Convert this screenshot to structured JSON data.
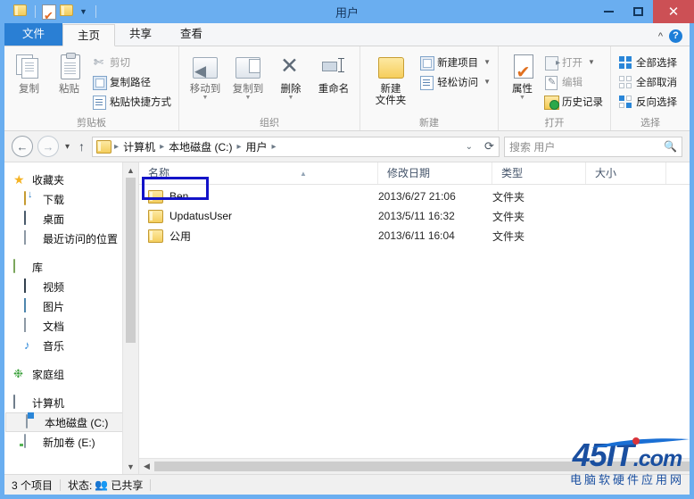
{
  "window": {
    "title": "用户",
    "controls": {
      "minimize": "最小化",
      "maximize": "最大化",
      "close": "关闭"
    }
  },
  "quick_access": {
    "items": [
      {
        "name": "folder-icon",
        "label": "属性"
      },
      {
        "name": "properties-icon",
        "label": "属性"
      },
      {
        "name": "new-folder-icon",
        "label": "新建文件夹"
      },
      {
        "name": "customize-caret",
        "label": "自定义快速访问工具栏"
      }
    ]
  },
  "tabs": [
    {
      "label": "文件",
      "kind": "file"
    },
    {
      "label": "主页",
      "kind": "active"
    },
    {
      "label": "共享",
      "kind": "normal"
    },
    {
      "label": "查看",
      "kind": "normal"
    }
  ],
  "tabbar_right": {
    "collapse": "^",
    "help": "?"
  },
  "ribbon": {
    "groups": [
      {
        "title": "剪贴板",
        "big": [
          {
            "label": "复制",
            "icon": "copy-icon"
          },
          {
            "label": "粘贴",
            "icon": "paste-icon"
          }
        ],
        "small": [
          {
            "label": "剪切",
            "icon": "cut-icon"
          },
          {
            "label": "复制路径",
            "icon": "copy-path-icon"
          },
          {
            "label": "粘贴快捷方式",
            "icon": "paste-shortcut-icon"
          }
        ]
      },
      {
        "title": "组织",
        "big": [
          {
            "label": "移动到",
            "icon": "move-to-icon"
          },
          {
            "label": "复制到",
            "icon": "copy-to-icon"
          },
          {
            "label": "删除",
            "icon": "delete-icon"
          },
          {
            "label": "重命名",
            "icon": "rename-icon"
          }
        ],
        "small": []
      },
      {
        "title": "新建",
        "big": [
          {
            "label": "新建\n文件夹",
            "label_line1": "新建",
            "label_line2": "文件夹",
            "icon": "new-folder-icon"
          }
        ],
        "small": [
          {
            "label": "新建项目",
            "icon": "new-item-icon"
          },
          {
            "label": "轻松访问",
            "icon": "easy-access-icon"
          }
        ]
      },
      {
        "title": "打开",
        "big": [
          {
            "label": "属性",
            "icon": "properties-icon"
          }
        ],
        "small": [
          {
            "label": "打开",
            "icon": "open-icon"
          },
          {
            "label": "编辑",
            "icon": "edit-icon"
          },
          {
            "label": "历史记录",
            "icon": "history-icon"
          }
        ]
      },
      {
        "title": "选择",
        "big": [],
        "small": [
          {
            "label": "全部选择",
            "icon": "select-all-icon"
          },
          {
            "label": "全部取消",
            "icon": "select-none-icon"
          },
          {
            "label": "反向选择",
            "icon": "invert-selection-icon"
          }
        ]
      }
    ]
  },
  "address_bar": {
    "back": "←",
    "forward": "→",
    "recent_caret": "▾",
    "up": "↑",
    "breadcrumbs": [
      "计算机",
      "本地磁盘 (C:)",
      "用户"
    ],
    "separator": "▸",
    "dropdown_caret": "⌄",
    "refresh": "⟳"
  },
  "search": {
    "placeholder": "搜索 用户",
    "icon": "search-icon"
  },
  "nav_pane": {
    "sections": [
      {
        "root": {
          "label": "收藏夹",
          "icon": "favorites-star-icon"
        },
        "items": [
          {
            "label": "下载",
            "icon": "downloads-icon"
          },
          {
            "label": "桌面",
            "icon": "desktop-icon"
          },
          {
            "label": "最近访问的位置",
            "icon": "recent-places-icon"
          }
        ]
      },
      {
        "root": {
          "label": "库",
          "icon": "libraries-icon"
        },
        "items": [
          {
            "label": "视频",
            "icon": "videos-icon"
          },
          {
            "label": "图片",
            "icon": "pictures-icon"
          },
          {
            "label": "文档",
            "icon": "documents-icon"
          },
          {
            "label": "音乐",
            "icon": "music-icon"
          }
        ]
      },
      {
        "root": {
          "label": "家庭组",
          "icon": "homegroup-icon"
        },
        "items": []
      },
      {
        "root": {
          "label": "计算机",
          "icon": "computer-icon"
        },
        "items": [
          {
            "label": "本地磁盘 (C:)",
            "icon": "drive-c-icon",
            "selected": true
          },
          {
            "label": "新加卷 (E:)",
            "icon": "drive-e-icon",
            "selected": false
          }
        ]
      }
    ]
  },
  "file_list": {
    "columns": [
      {
        "label": "名称"
      },
      {
        "label": "修改日期"
      },
      {
        "label": "类型"
      },
      {
        "label": "大小"
      }
    ],
    "sort_indicator": "▲",
    "rows": [
      {
        "name": "Ben",
        "date": "2013/6/27 21:06",
        "type": "文件夹",
        "size": "",
        "highlighted": true
      },
      {
        "name": "UpdatusUser",
        "date": "2013/5/11 16:32",
        "type": "文件夹",
        "size": "",
        "highlighted": false
      },
      {
        "name": "公用",
        "date": "2013/6/11 16:04",
        "type": "文件夹",
        "size": "",
        "highlighted": false
      }
    ]
  },
  "status_bar": {
    "item_count": "3 个项目",
    "state_label": "状态:",
    "state_value": "已共享",
    "state_icon": "shared-users-icon"
  },
  "watermark": {
    "main": "45IT",
    "suffix": ".com",
    "tagline": "电脑软硬件应用网"
  },
  "colors": {
    "title_bar": "#6aaef0",
    "file_tab": "#2a7fd4",
    "close_button": "#cc5055",
    "highlight_box": "#1313c8",
    "watermark": "#1a4fa0"
  }
}
